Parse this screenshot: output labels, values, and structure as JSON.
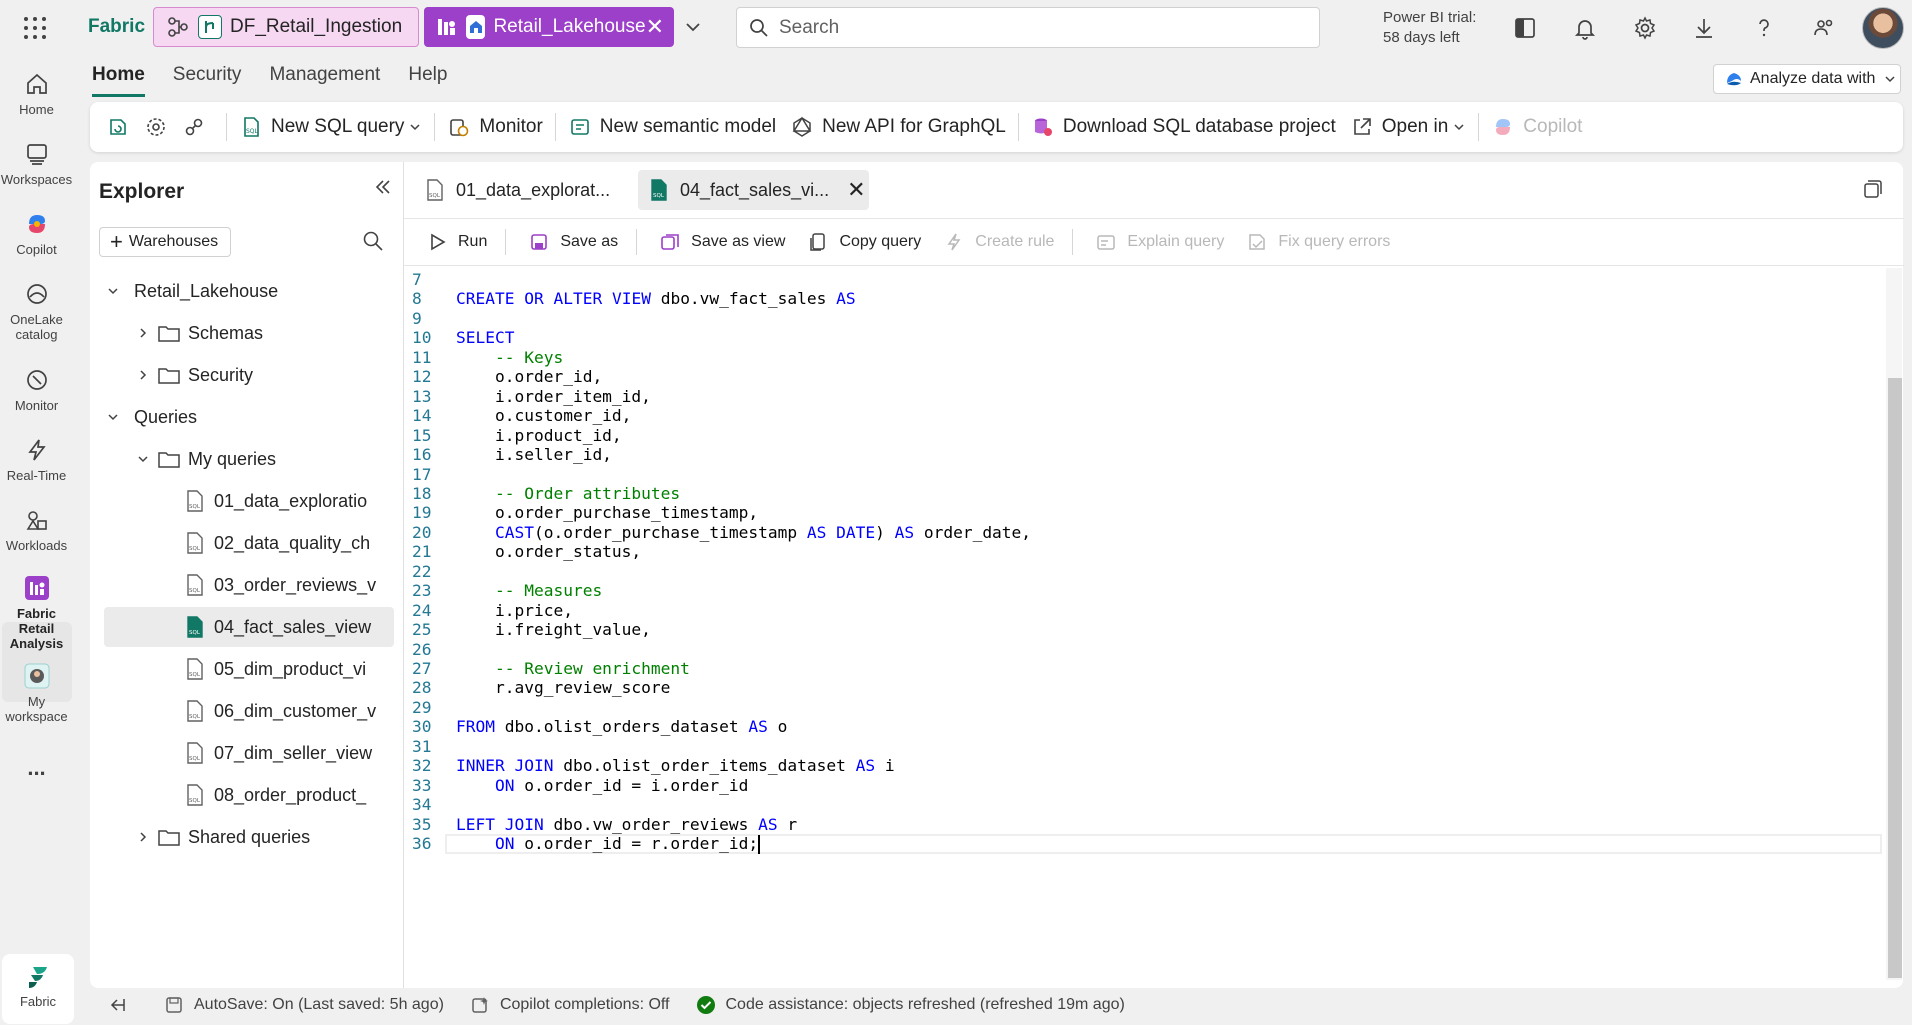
{
  "topbar": {
    "brand": "Fabric",
    "pipeline_tab": "DF_Retail_Ingestion",
    "lakehouse_tab": "Retail_Lakehouse",
    "search_placeholder": "Search",
    "trial_line1": "Power BI trial:",
    "trial_line2": "58 days left"
  },
  "rail": {
    "items": [
      {
        "label": "Home",
        "icon": "home-icon"
      },
      {
        "label": "Workspaces",
        "icon": "workspaces-icon"
      },
      {
        "label": "Copilot",
        "icon": "copilot-icon"
      },
      {
        "label_1": "OneLake",
        "label_2": "catalog",
        "icon": "onelake-icon"
      },
      {
        "label": "Monitor",
        "icon": "monitor-icon"
      },
      {
        "label": "Real-Time",
        "icon": "realtime-icon"
      },
      {
        "label": "Workloads",
        "icon": "workloads-icon"
      },
      {
        "label_1": "Fabric Retail",
        "label_2": "Analysis",
        "icon": "workspace-icon"
      },
      {
        "label_1": "My",
        "label_2": "workspace",
        "icon": "my-workspace-icon"
      }
    ],
    "more": "...",
    "fabric_label": "Fabric"
  },
  "menu": {
    "tabs": [
      "Home",
      "Security",
      "Management",
      "Help"
    ],
    "analyze_label": "Analyze data with"
  },
  "ribbon": {
    "new_sql_query": "New SQL query",
    "monitor": "Monitor",
    "new_semantic_model": "New semantic model",
    "new_api_graphql": "New API for GraphQL",
    "download_project": "Download SQL database project",
    "open_in": "Open in",
    "copilot": "Copilot"
  },
  "explorer": {
    "title": "Explorer",
    "warehouses_button": "Warehouses",
    "tree": {
      "lakehouse": "Retail_Lakehouse",
      "schemas": "Schemas",
      "security": "Security",
      "queries": "Queries",
      "my_queries": "My queries",
      "files": [
        "01_data_exploratio",
        "02_data_quality_ch",
        "03_order_reviews_v",
        "04_fact_sales_view",
        "05_dim_product_vi",
        "06_dim_customer_v",
        "07_dim_seller_view",
        "08_order_product_"
      ],
      "shared_queries": "Shared queries"
    }
  },
  "editor": {
    "tabs": [
      {
        "label": "01_data_explorat...",
        "active": false
      },
      {
        "label": "04_fact_sales_vi...",
        "active": true
      }
    ],
    "toolbar": {
      "run": "Run",
      "save_as": "Save as",
      "save_as_view": "Save as view",
      "copy_query": "Copy query",
      "create_rule": "Create rule",
      "explain_query": "Explain query",
      "fix_query_errors": "Fix query errors"
    },
    "code_lines": [
      {
        "n": "7",
        "t": ""
      },
      {
        "n": "8",
        "t": "CREATE OR ALTER VIEW dbo.vw_fact_sales AS"
      },
      {
        "n": "9",
        "t": ""
      },
      {
        "n": "10",
        "t": "SELECT"
      },
      {
        "n": "11",
        "t": "    -- Keys"
      },
      {
        "n": "12",
        "t": "    o.order_id,"
      },
      {
        "n": "13",
        "t": "    i.order_item_id,"
      },
      {
        "n": "14",
        "t": "    o.customer_id,"
      },
      {
        "n": "15",
        "t": "    i.product_id,"
      },
      {
        "n": "16",
        "t": "    i.seller_id,"
      },
      {
        "n": "17",
        "t": ""
      },
      {
        "n": "18",
        "t": "    -- Order attributes"
      },
      {
        "n": "19",
        "t": "    o.order_purchase_timestamp,"
      },
      {
        "n": "20",
        "t": "    CAST(o.order_purchase_timestamp AS DATE) AS order_date,"
      },
      {
        "n": "21",
        "t": "    o.order_status,"
      },
      {
        "n": "22",
        "t": ""
      },
      {
        "n": "23",
        "t": "    -- Measures"
      },
      {
        "n": "24",
        "t": "    i.price,"
      },
      {
        "n": "25",
        "t": "    i.freight_value,"
      },
      {
        "n": "26",
        "t": ""
      },
      {
        "n": "27",
        "t": "    -- Review enrichment"
      },
      {
        "n": "28",
        "t": "    r.avg_review_score"
      },
      {
        "n": "29",
        "t": ""
      },
      {
        "n": "30",
        "t": "FROM dbo.olist_orders_dataset AS o"
      },
      {
        "n": "31",
        "t": ""
      },
      {
        "n": "32",
        "t": "INNER JOIN dbo.olist_order_items_dataset AS i"
      },
      {
        "n": "33",
        "t": "    ON o.order_id = i.order_id"
      },
      {
        "n": "34",
        "t": ""
      },
      {
        "n": "35",
        "t": "LEFT JOIN dbo.vw_order_reviews AS r"
      },
      {
        "n": "36",
        "t": "    ON o.order_id = r.order_id;"
      }
    ]
  },
  "status": {
    "autosave": "AutoSave: On (Last saved: 5h ago)",
    "copilot_completions": "Copilot completions: Off",
    "code_assistance": "Code assistance: objects refreshed (refreshed 19m ago)"
  },
  "colors": {
    "accent": "#117865",
    "keyword": "#0000ff",
    "comment": "#008000",
    "line_number": "#237893",
    "lakehouse_tab_bg": "#9c3fc9",
    "pipeline_tab_bg": "#f6d8f2"
  }
}
